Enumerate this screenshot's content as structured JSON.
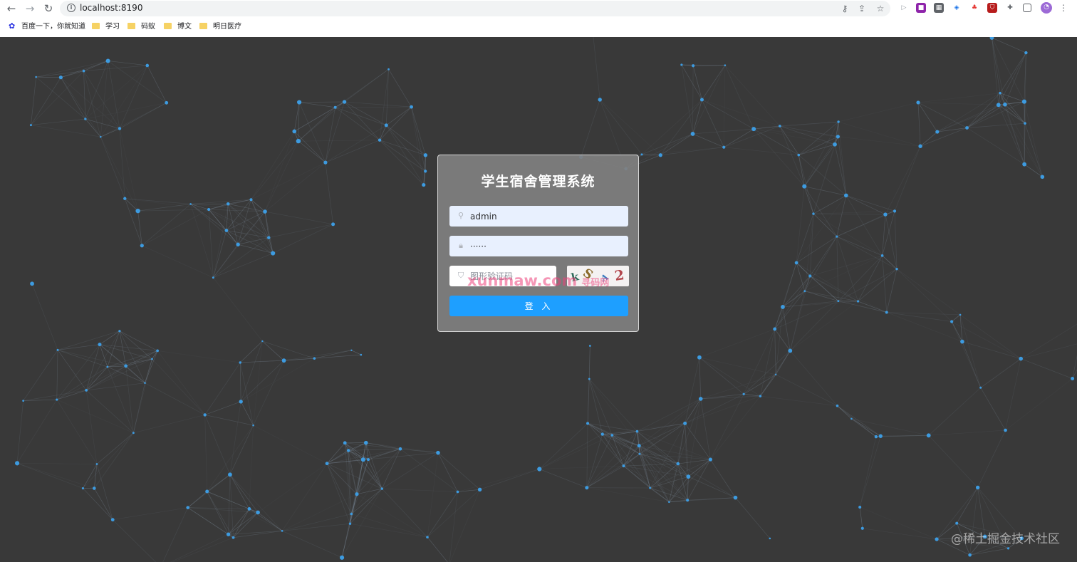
{
  "browser": {
    "url": "localhost:8190",
    "back_icon": "arrow-left-icon",
    "forward_icon": "arrow-right-icon",
    "reload_icon": "reload-icon",
    "bookmarks": [
      {
        "label": "百度一下，你就知道",
        "icon": "baidu-paw-icon"
      },
      {
        "label": "学习",
        "icon": "folder-icon"
      },
      {
        "label": "码蚁",
        "icon": "folder-icon"
      },
      {
        "label": "博文",
        "icon": "folder-icon"
      },
      {
        "label": "明日医疗",
        "icon": "folder-icon"
      }
    ]
  },
  "login": {
    "title": "学生宿舍管理系统",
    "username_value": "admin",
    "password_value": "······",
    "captcha_placeholder": "图形验证码",
    "captcha_chars": [
      "k",
      "S",
      "A",
      "2"
    ],
    "submit_label": "登 入"
  },
  "watermarks": {
    "site": "xunmaw.com",
    "site_cn": "寻码网",
    "corner": "@稀土掘金技术社区"
  },
  "colors": {
    "background": "#393939",
    "button": "#1e9fff",
    "node": "#3d9be0"
  }
}
